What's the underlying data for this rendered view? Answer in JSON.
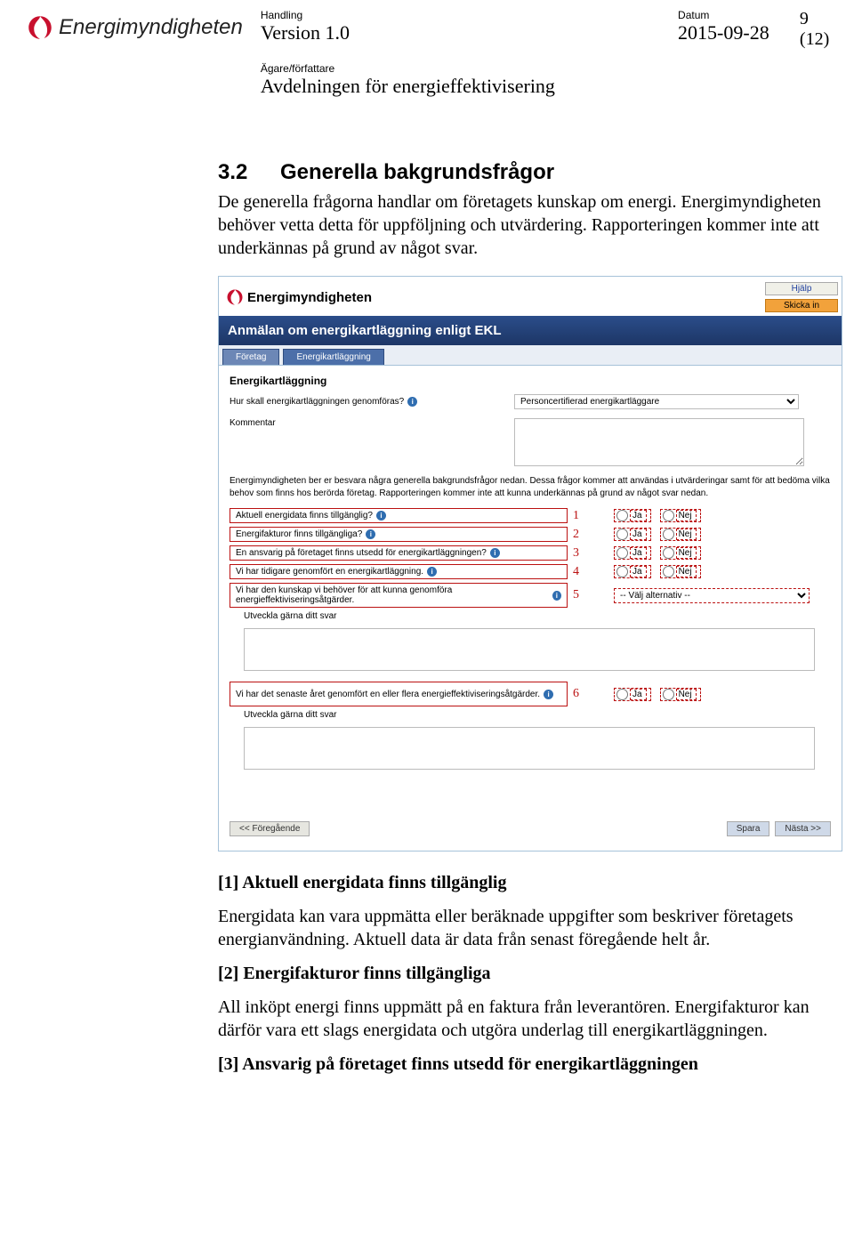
{
  "header": {
    "handling_label": "Handling",
    "version": "Version 1.0",
    "datum_label": "Datum",
    "date": "2015-09-28",
    "page_counter": "9 (12)",
    "agare_label": "Ägare/författare",
    "agare_value": "Avdelningen för energieffektivisering",
    "brand": "Energimyndigheten"
  },
  "section": {
    "num": "3.2",
    "title": "Generella bakgrundsfrågor",
    "intro": "De generella frågorna handlar om företagets kunskap om energi. Energimyndigheten behöver vetta detta för uppföljning och utvärdering. Rapporteringen kommer inte att underkännas på grund av något svar."
  },
  "screenshot": {
    "brand": "Energimyndigheten",
    "help": "Hjälp",
    "submit": "Skicka in",
    "title": "Anmälan om energikartläggning enligt EKL",
    "tabs": {
      "t1": "Företag",
      "t2": "Energikartläggning"
    },
    "section_h": "Energikartläggning",
    "q0_label": "Hur skall energikartläggningen genomföras?",
    "q0_select": "Personcertifierad energikartläggare",
    "comment_label": "Kommentar",
    "info_text": "Energimyndigheten ber er besvara några generella bakgrundsfrågor nedan. Dessa frågor kommer att användas i utvärderingar samt för att bedöma vilka behov som finns hos berörda företag. Rapporteringen kommer inte att kunna underkännas på grund av något svar nedan.",
    "q1": "Aktuell energidata finns tillgänglig?",
    "q2": "Energifakturor finns tillgängliga?",
    "q3": "En ansvarig på företaget finns utsedd för energikartläggningen?",
    "q4": "Vi har tidigare genomfört en energikartläggning.",
    "q5": "Vi har den kunskap vi behöver för att kunna genomföra energieffektiviseringsåtgärder.",
    "q5_select": "-- Välj alternativ --",
    "q5_sub": "Utveckla gärna ditt svar",
    "q6": "Vi har det senaste året genomfört en eller flera energieffektiviseringsåtgärder.",
    "q6_sub": "Utveckla gärna ditt svar",
    "yes": "Ja",
    "no": "Nej",
    "nums": {
      "n1": "1",
      "n2": "2",
      "n3": "3",
      "n4": "4",
      "n5": "5",
      "n6": "6"
    },
    "prev": "<< Föregående",
    "save": "Spara",
    "next": "Nästa >>"
  },
  "explanations": {
    "e1_h": "[1] Aktuell energidata finns tillgänglig",
    "e1_p": "Energidata kan vara uppmätta eller beräknade uppgifter som beskriver företagets energianvändning. Aktuell data är data från senast föregående helt år.",
    "e2_h": "[2] Energifakturor finns tillgängliga",
    "e2_p": "All inköpt energi finns uppmätt på en faktura från leverantören. Energifakturor kan därför vara ett slags energidata och utgöra underlag till energikartläggningen.",
    "e3_h": "[3] Ansvarig på företaget finns utsedd för energikartläggningen"
  }
}
